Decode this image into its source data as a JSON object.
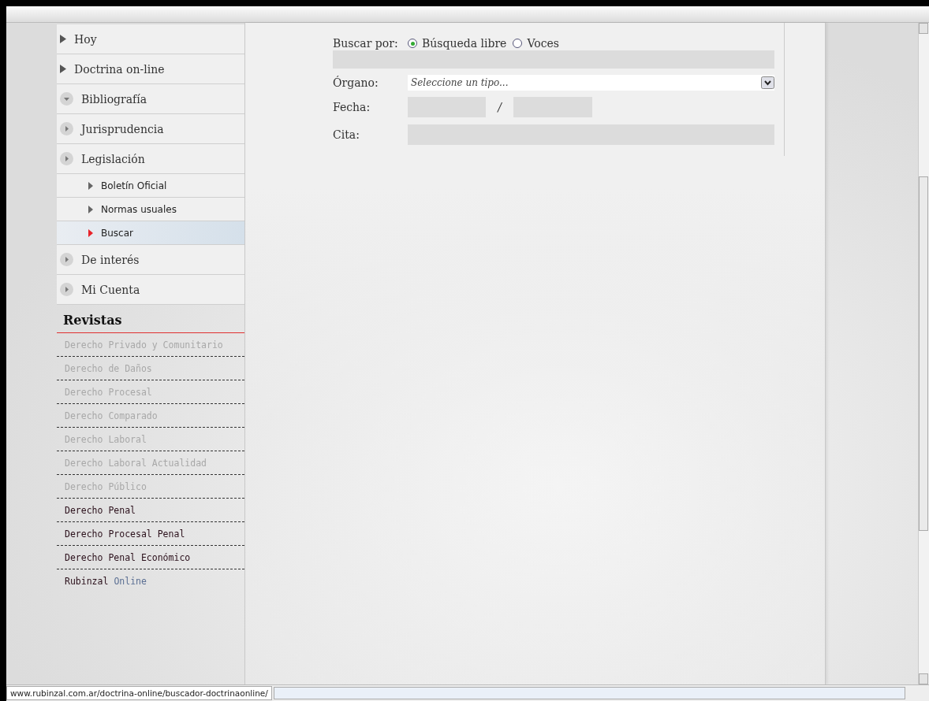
{
  "nav": {
    "items": [
      {
        "label": "Hoy",
        "kind": "link",
        "selected": false
      },
      {
        "label": "Doctrina on-line",
        "kind": "link",
        "selected": false
      },
      {
        "label": "Bibliografía",
        "kind": "section",
        "expanded": true,
        "selected": false
      },
      {
        "label": "Jurisprudencia",
        "kind": "section",
        "expanded": false,
        "selected": false
      },
      {
        "label": "Legislación",
        "kind": "section",
        "expanded": false,
        "selected": false,
        "children": [
          {
            "label": "Boletín Oficial",
            "selected": false
          },
          {
            "label": "Normas usuales",
            "selected": false
          },
          {
            "label": "Buscar",
            "selected": true
          }
        ]
      },
      {
        "label": "De interés",
        "kind": "section",
        "expanded": false,
        "selected": false
      },
      {
        "label": "Mi Cuenta",
        "kind": "section",
        "expanded": false,
        "selected": false
      }
    ]
  },
  "revistas": {
    "title": "Revistas",
    "items": [
      {
        "label": "Derecho Privado y Comunitario",
        "disabled": true
      },
      {
        "label": "Derecho de Daños",
        "disabled": true
      },
      {
        "label": "Derecho Procesal",
        "disabled": true
      },
      {
        "label": "Derecho Comparado",
        "disabled": true
      },
      {
        "label": "Derecho Laboral",
        "disabled": true
      },
      {
        "label": "Derecho Laboral Actualidad",
        "disabled": true
      },
      {
        "label": "Derecho Público",
        "disabled": true
      },
      {
        "label": "Derecho Penal",
        "disabled": false
      },
      {
        "label": "Derecho Procesal Penal",
        "disabled": false
      },
      {
        "label": "Derecho Penal Económico",
        "disabled": false
      }
    ],
    "online_link": {
      "brand": "Rubinzal",
      "suffix": "Online"
    }
  },
  "form": {
    "search_by": {
      "label": "Buscar por:",
      "options": [
        {
          "label": "Búsqueda libre",
          "selected": true
        },
        {
          "label": "Voces",
          "selected": false
        }
      ]
    },
    "organo": {
      "label": "Órgano:",
      "placeholder": "Seleccione un tipo..."
    },
    "fecha": {
      "label": "Fecha:",
      "separator": "/"
    },
    "cita": {
      "label": "Cita:"
    }
  },
  "status_bar": {
    "url": "www.rubinzal.com.ar/doctrina-online/buscador-doctrinaonline/"
  }
}
